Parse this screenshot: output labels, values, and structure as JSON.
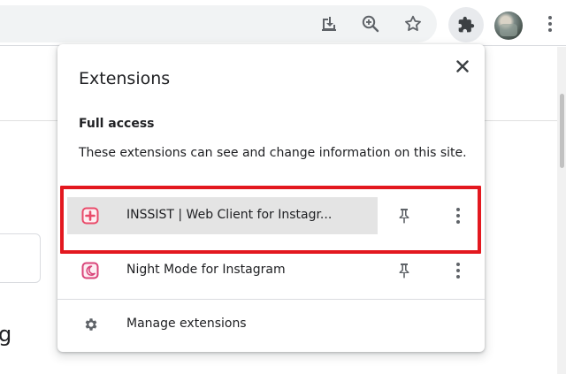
{
  "popup": {
    "title": "Extensions",
    "section_title": "Full access",
    "section_description": "These extensions can see and change information on this site.",
    "close_icon": "close-icon"
  },
  "extensions": [
    {
      "name": "INSSIST | Web Client for Instagr...",
      "icon": "inssist-extension-icon",
      "pin_icon": "pin-icon",
      "more_icon": "more-vert-icon",
      "highlighted": true
    },
    {
      "name": "Night Mode for Instagram",
      "icon": "night-mode-extension-icon",
      "pin_icon": "pin-icon",
      "more_icon": "more-vert-icon",
      "highlighted": false
    }
  ],
  "manage": {
    "label": "Manage extensions",
    "icon": "gear-icon"
  },
  "toolbar": {
    "icons": [
      "install-app-icon",
      "zoom-icon",
      "bookmark-star-icon",
      "extensions-puzzle-icon",
      "avatar",
      "more-vert-icon"
    ]
  },
  "page_behind": {
    "glyph": "g"
  },
  "colors": {
    "highlight_outline": "#e3181f",
    "inssist_brand": "#e94b6a",
    "night_mode_brand": "#d9457a",
    "row_hover": "#e4e4e4"
  }
}
